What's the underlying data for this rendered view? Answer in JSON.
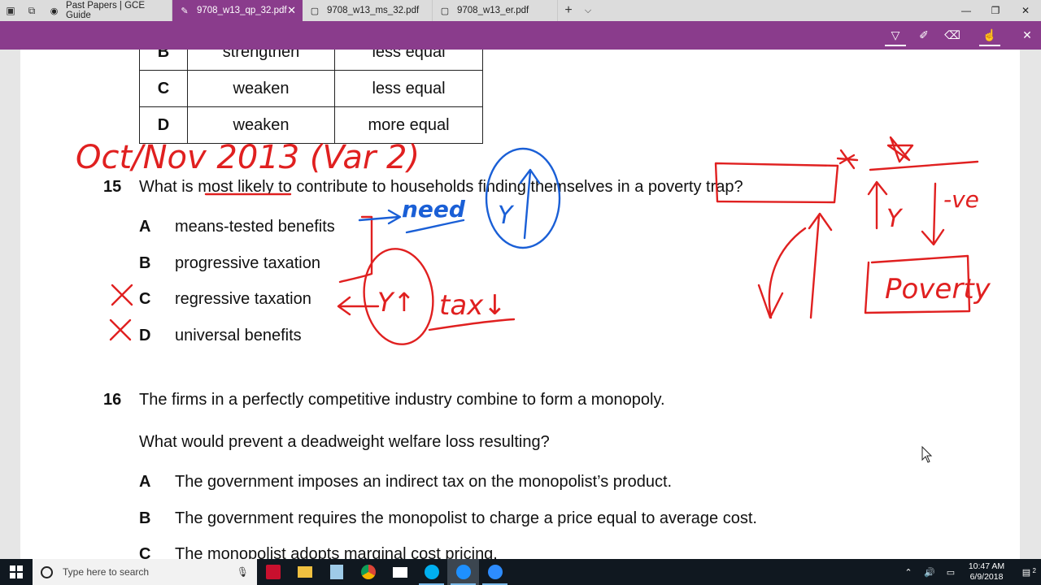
{
  "browser": {
    "tabs": [
      {
        "label": "Past Papers | GCE Guide",
        "icon": "gce-guide-icon"
      },
      {
        "label": "9708_w13_qp_32.pdf",
        "icon": "pdf-pen-icon",
        "active": true
      },
      {
        "label": "9708_w13_ms_32.pdf",
        "icon": "page-icon"
      },
      {
        "label": "9708_w13_er.pdf",
        "icon": "page-icon"
      }
    ],
    "accent": "#8a3c8c"
  },
  "table": {
    "rows": [
      [
        "B",
        "strengthen",
        "less equal"
      ],
      [
        "C",
        "weaken",
        "less equal"
      ],
      [
        "D",
        "weaken",
        "more equal"
      ]
    ]
  },
  "q15": {
    "number": "15",
    "q_before": "What is ",
    "q_underlined": "most likely",
    "q_after": " to contribute to households finding themselves in a poverty trap?",
    "options": [
      {
        "letter": "A",
        "text": "means-tested benefits"
      },
      {
        "letter": "B",
        "text": "progressive taxation"
      },
      {
        "letter": "C",
        "text": "regressive taxation"
      },
      {
        "letter": "D",
        "text": "universal benefits"
      }
    ]
  },
  "q16": {
    "number": "16",
    "line1": "The firms in a perfectly competitive industry combine to form a monopoly.",
    "line2": "What would prevent a deadweight welfare loss resulting?",
    "options": [
      {
        "letter": "A",
        "text": "The government imposes an indirect tax on the monopolist’s product."
      },
      {
        "letter": "B",
        "text": "The government requires the monopolist to charge a price equal to average cost."
      },
      {
        "letter": "C",
        "text": "The monopolist adopts marginal cost pricing."
      }
    ]
  },
  "annotations": {
    "title": "Oct/Nov 2013 (Var 2)",
    "need": "need",
    "y_up": "Y↑",
    "tax_down": "tax↓",
    "y": "Y",
    "neg": "-ve",
    "poverty": "Poverty",
    "red": "#e02020",
    "blue": "#1a5fd6"
  },
  "taskbar": {
    "search_placeholder": "Type here to search",
    "time": "10:47 AM",
    "date": "6/9/2018",
    "notifications": "2"
  }
}
